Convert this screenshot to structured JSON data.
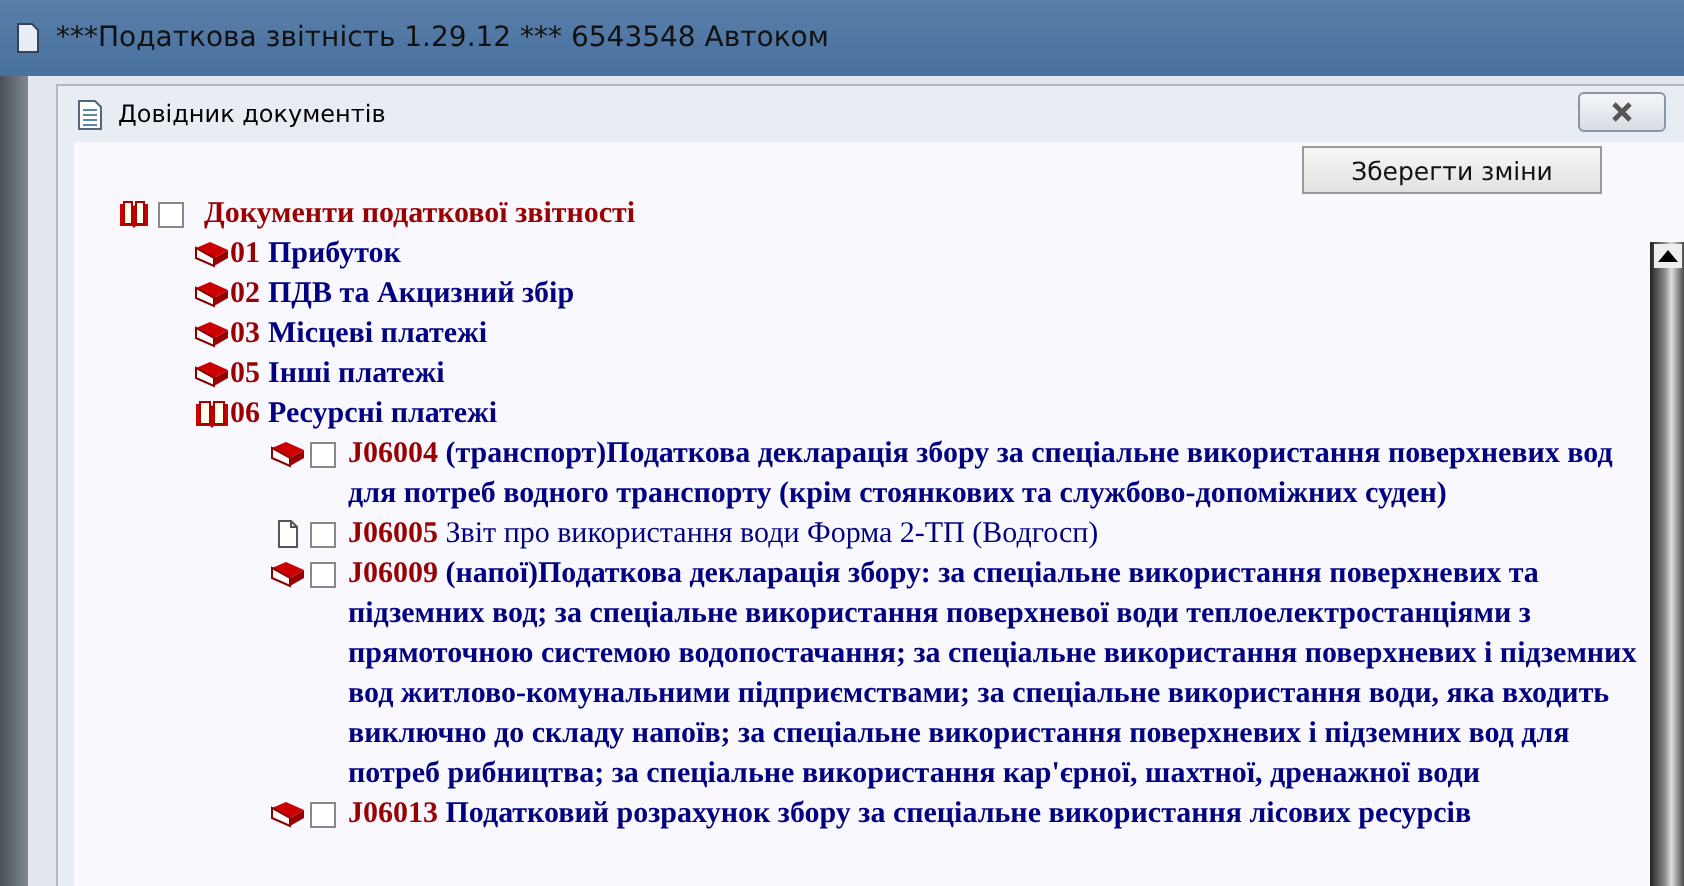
{
  "window": {
    "title": "***Податкова звітність 1.29.12 *** 6543548 Автоком"
  },
  "dialog": {
    "title": "Довідник документів",
    "save_button": "Зберегти зміни"
  },
  "tree": {
    "label": "Документи податкової звітності",
    "expanded": true,
    "checked": false,
    "children": [
      {
        "code": "01",
        "label": "Прибуток",
        "expanded": false
      },
      {
        "code": "02",
        "label": "ПДВ та Акцизний збір",
        "expanded": false
      },
      {
        "code": "03",
        "label": "Місцеві платежі",
        "expanded": false
      },
      {
        "code": "05",
        "label": "Інші платежі",
        "expanded": false
      },
      {
        "code": "06",
        "label": "Ресурсні платежі",
        "expanded": true,
        "children": [
          {
            "kind": "book",
            "checked": false,
            "bold": true,
            "code": "J06004",
            "label": " (транспорт)Податкова декларація збору за спеціальне використання поверхневих вод для потреб водного транспорту (крім стоянкових та службово-допоміжних суден)"
          },
          {
            "kind": "page",
            "checked": false,
            "bold": false,
            "code": "J06005",
            "label": " Звіт про використання води Форма 2-ТП (Водгосп)"
          },
          {
            "kind": "book",
            "checked": false,
            "bold": true,
            "code": "J06009",
            "label": " (напої)Податкова декларація збору: за спеціальне використання поверхневих та підземних вод; за спеціальне використання поверхневої води теплоелектростанціями з прямоточною системою водопостачання; за спеціальне використання поверхневих і підземних вод житлово-комунальними підприємствами; за спеціальне використання води, яка входить виключно до складу напоїв; за спеціальне використання поверхневих і підземних вод для потреб рибництва; за спеціальне використання кар'єрної, шахтної, дренажної води"
          },
          {
            "kind": "book",
            "checked": false,
            "bold": true,
            "code": "J06013",
            "label": " Податковий розрахунок збору за спеціальне використання лісових ресурсів"
          }
        ]
      }
    ]
  }
}
